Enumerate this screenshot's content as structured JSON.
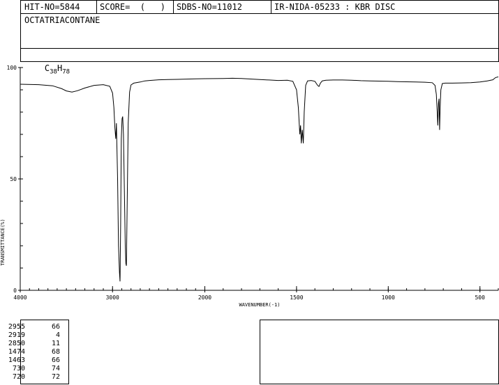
{
  "header": {
    "hit_no": "HIT-NO=5844",
    "score": "SCORE=  (   )",
    "sdbs_no": "SDBS-NO=11012",
    "method": "IR-NIDA-05233 : KBR DISC",
    "compound_name": "OCTATRIACONTANE",
    "formula_c": "C",
    "formula_c_sub": "38",
    "formula_h": "H",
    "formula_h_sub": "78"
  },
  "chart_data": {
    "type": "line",
    "xlabel": "WAVENUMBER(-1)",
    "ylabel": "TRANSMITTANCE(%)",
    "xlim": [
      4000,
      400
    ],
    "ylim": [
      0,
      100
    ],
    "x_ticks": [
      4000,
      3000,
      2000,
      1500,
      1000,
      500
    ],
    "y_ticks": [
      0,
      50,
      100
    ],
    "line_color": "#000000",
    "points": [
      [
        4000,
        92.5
      ],
      [
        3800,
        92.3
      ],
      [
        3650,
        91.8
      ],
      [
        3550,
        90.5
      ],
      [
        3500,
        89.5
      ],
      [
        3440,
        89.0
      ],
      [
        3380,
        89.6
      ],
      [
        3300,
        90.8
      ],
      [
        3200,
        92.0
      ],
      [
        3100,
        92.3
      ],
      [
        3030,
        91.6
      ],
      [
        3000,
        88.5
      ],
      [
        2985,
        82
      ],
      [
        2975,
        73
      ],
      [
        2965,
        68
      ],
      [
        2958,
        75
      ],
      [
        2945,
        50
      ],
      [
        2935,
        20
      ],
      [
        2925,
        8
      ],
      [
        2919,
        4
      ],
      [
        2912,
        30
      ],
      [
        2905,
        68
      ],
      [
        2897,
        77
      ],
      [
        2890,
        78
      ],
      [
        2882,
        70
      ],
      [
        2872,
        45
      ],
      [
        2862,
        20
      ],
      [
        2855,
        12
      ],
      [
        2850,
        11
      ],
      [
        2842,
        35
      ],
      [
        2830,
        75
      ],
      [
        2815,
        89
      ],
      [
        2800,
        92.2
      ],
      [
        2770,
        93.0
      ],
      [
        2700,
        93.5
      ],
      [
        2650,
        94.0
      ],
      [
        2600,
        94.2
      ],
      [
        2500,
        94.5
      ],
      [
        2400,
        94.6
      ],
      [
        2300,
        94.7
      ],
      [
        2200,
        94.8
      ],
      [
        2100,
        94.9
      ],
      [
        2000,
        95.0
      ],
      [
        1900,
        95.1
      ],
      [
        1850,
        95.2
      ],
      [
        1800,
        95.1
      ],
      [
        1700,
        94.6
      ],
      [
        1650,
        94.4
      ],
      [
        1600,
        94.2
      ],
      [
        1550,
        94.3
      ],
      [
        1520,
        93.8
      ],
      [
        1500,
        90
      ],
      [
        1490,
        82
      ],
      [
        1482,
        70
      ],
      [
        1478,
        74
      ],
      [
        1474,
        66
      ],
      [
        1469,
        72
      ],
      [
        1463,
        66
      ],
      [
        1458,
        80
      ],
      [
        1450,
        92
      ],
      [
        1440,
        94.0
      ],
      [
        1420,
        94.2
      ],
      [
        1400,
        93.8
      ],
      [
        1385,
        92
      ],
      [
        1378,
        91.5
      ],
      [
        1370,
        93.0
      ],
      [
        1360,
        94.0
      ],
      [
        1340,
        94.3
      ],
      [
        1300,
        94.4
      ],
      [
        1250,
        94.4
      ],
      [
        1200,
        94.3
      ],
      [
        1150,
        94.1
      ],
      [
        1100,
        94.0
      ],
      [
        1050,
        93.9
      ],
      [
        1000,
        93.8
      ],
      [
        950,
        93.7
      ],
      [
        900,
        93.6
      ],
      [
        850,
        93.5
      ],
      [
        800,
        93.4
      ],
      [
        760,
        93.2
      ],
      [
        745,
        92.0
      ],
      [
        738,
        88
      ],
      [
        733,
        80
      ],
      [
        730,
        74
      ],
      [
        726,
        84
      ],
      [
        723,
        86
      ],
      [
        720,
        72
      ],
      [
        717,
        82
      ],
      [
        713,
        90
      ],
      [
        705,
        92.8
      ],
      [
        690,
        93.0
      ],
      [
        650,
        93.0
      ],
      [
        600,
        93.1
      ],
      [
        550,
        93.2
      ],
      [
        500,
        93.5
      ],
      [
        460,
        94.0
      ],
      [
        430,
        94.5
      ],
      [
        415,
        95.5
      ],
      [
        400,
        95.8
      ]
    ]
  },
  "peaks": [
    {
      "wavenumber": "2955",
      "transmittance": "66"
    },
    {
      "wavenumber": "2919",
      "transmittance": "4"
    },
    {
      "wavenumber": "2850",
      "transmittance": "11"
    },
    {
      "wavenumber": "1474",
      "transmittance": "68"
    },
    {
      "wavenumber": "1463",
      "transmittance": "66"
    },
    {
      "wavenumber": "730",
      "transmittance": "74"
    },
    {
      "wavenumber": "720",
      "transmittance": "72"
    }
  ]
}
